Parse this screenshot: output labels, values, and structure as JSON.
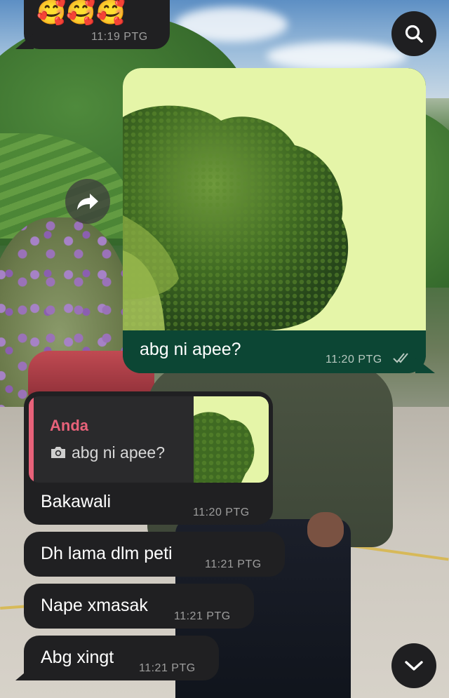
{
  "messages": {
    "top": {
      "emojis": "🥰🥰🥰",
      "time": "11:19 PTG"
    },
    "outgoing": {
      "caption": "abg ni apee?",
      "time": "11:20 PTG",
      "status_icon": "double-check-icon"
    },
    "reply": {
      "quoted_author": "Anda",
      "quoted_text": "abg ni apee?",
      "quoted_icon": "camera-icon",
      "text": "Bakawali",
      "time": "11:20 PTG"
    },
    "incoming": [
      {
        "text": "Dh lama dlm peti",
        "time": "11:21 PTG"
      },
      {
        "text": "Nape xmasak",
        "time": "11:21 PTG"
      },
      {
        "text": "Abg xingt",
        "time": "11:21 PTG"
      }
    ]
  },
  "controls": {
    "search_icon": "search-icon",
    "forward_icon": "forward-share-icon",
    "scroll_down_icon": "chevron-down-icon"
  },
  "colors": {
    "incoming_bubble": "#202022",
    "outgoing_bubble": "#0c4634",
    "reply_accent": "#e8627a",
    "image_background": "#e5f5a8"
  }
}
